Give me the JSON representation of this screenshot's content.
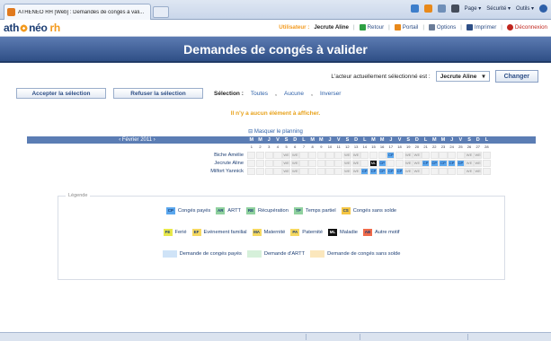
{
  "browser": {
    "tab_title": "ATHÉNÉO RH [Web] : Demandes de congés à vali...",
    "tools": [
      {
        "name": "home-icon",
        "color": "#3d7ecb"
      },
      {
        "name": "feeds-icon",
        "color": "#e8891b"
      },
      {
        "name": "mail-icon",
        "color": "#6f8fb8"
      },
      {
        "name": "print-icon",
        "color": "#444c5a"
      }
    ],
    "page_menu": "Page ▾",
    "security_menu": "Sécurité ▾",
    "tools_menu": "Outils ▾",
    "help_icon": "help-icon"
  },
  "header": {
    "logo_main": "ath",
    "logo_mid": "néo",
    "logo_rh": "rh",
    "user_label": "Utilisateur :",
    "user_name": "Jecrute Aline",
    "nav": [
      {
        "label": "Retour",
        "icon": "back-icon",
        "color": "#2ea043"
      },
      {
        "label": "Portail",
        "icon": "portal-icon",
        "color": "#e8891b"
      },
      {
        "label": "Options",
        "icon": "options-icon",
        "color": "#6a7c98"
      },
      {
        "label": "Imprimer",
        "icon": "print-icon",
        "color": "#2e4f86"
      }
    ],
    "logout": "Déconnexion"
  },
  "title": "Demandes de congés à valider",
  "actor": {
    "label": "L'acteur actuellement sélectionné est :",
    "selected": "Jecrute Aline",
    "change_button": "Changer"
  },
  "actions": {
    "accept": "Accepter la sélection",
    "refuse": "Refuser la sélection",
    "selection_label": "Sélection :",
    "links": [
      "Toutes",
      "Aucune",
      "Inverser"
    ]
  },
  "empty_message": "Il n'y a aucun élément à afficher.",
  "hide_planning": "Masquer le planning",
  "planning": {
    "month": "‹ Février 2011 ›",
    "day_letters": [
      "M",
      "M",
      "J",
      "V",
      "S",
      "D",
      "L",
      "M",
      "M",
      "J",
      "V",
      "S",
      "D",
      "L",
      "M",
      "M",
      "J",
      "V",
      "S",
      "D",
      "L",
      "M",
      "M",
      "J",
      "V",
      "S",
      "D",
      "L"
    ],
    "day_numbers": [
      "1",
      "2",
      "3",
      "4",
      "5",
      "6",
      "7",
      "8",
      "9",
      "10",
      "11",
      "12",
      "13",
      "14",
      "15",
      "16",
      "17",
      "18",
      "19",
      "20",
      "21",
      "22",
      "23",
      "24",
      "25",
      "26",
      "27",
      "28"
    ],
    "employees": [
      {
        "name": "Biche Amélie",
        "cells": [
          "",
          "",
          "",
          "",
          "WE",
          "WE",
          "",
          "",
          "",
          "",
          "",
          "WE",
          "WE",
          "",
          "",
          "",
          "CP",
          "",
          "WE",
          "WE",
          "",
          "",
          "",
          "",
          "",
          "WE",
          "WE",
          ""
        ]
      },
      {
        "name": "Jecrute Aline",
        "cells": [
          "",
          "",
          "",
          "",
          "WE",
          "WE",
          "",
          "",
          "",
          "",
          "",
          "WE",
          "WE",
          "",
          "ML",
          "CP",
          "",
          "",
          "WE",
          "WE",
          "CP",
          "CP",
          "CP",
          "CP",
          "CP",
          "WE",
          "WE",
          ""
        ]
      },
      {
        "name": "Milfort Yannick",
        "cells": [
          "",
          "",
          "",
          "",
          "WE",
          "WE",
          "",
          "",
          "",
          "",
          "",
          "WE",
          "WE",
          "CP",
          "CP",
          "CP",
          "CP",
          "CP",
          "WE",
          "WE",
          "",
          "",
          "",
          "",
          "",
          "WE",
          "WE",
          ""
        ]
      }
    ]
  },
  "legend": {
    "title": "Légende",
    "row1": [
      {
        "code": "CP",
        "label": "Congés payés",
        "color": "#5aa7ee"
      },
      {
        "code": "AR",
        "label": "ARTT",
        "color": "#8fd19e"
      },
      {
        "code": "RE",
        "label": "Récupération",
        "color": "#8fd19e"
      },
      {
        "code": "TP",
        "label": "Temps partiel",
        "color": "#8fd19e"
      },
      {
        "code": "CS",
        "label": "Congés sans solde",
        "color": "#f5c542"
      }
    ],
    "row2": [
      {
        "code": "FE",
        "label": "Ferié",
        "color": "#e8e84a"
      },
      {
        "code": "EF",
        "label": "Evénement familial",
        "color": "#f5d860"
      },
      {
        "code": "MA",
        "label": "Maternité",
        "color": "#f5d860"
      },
      {
        "code": "PA",
        "label": "Paternité",
        "color": "#f5d860"
      },
      {
        "code": "ML",
        "label": "Maladie",
        "color": "#111111"
      },
      {
        "code": "AB",
        "label": "Autre motif",
        "color": "#f06a4a"
      }
    ],
    "row3": [
      {
        "code": "",
        "label": "Demande de congés payés",
        "color": "#cfe3f7"
      },
      {
        "code": "",
        "label": "Demande d'ARTT",
        "color": "#d6f0da"
      },
      {
        "code": "",
        "label": "Demande de congés sans solde",
        "color": "#fbe7bd"
      }
    ]
  }
}
